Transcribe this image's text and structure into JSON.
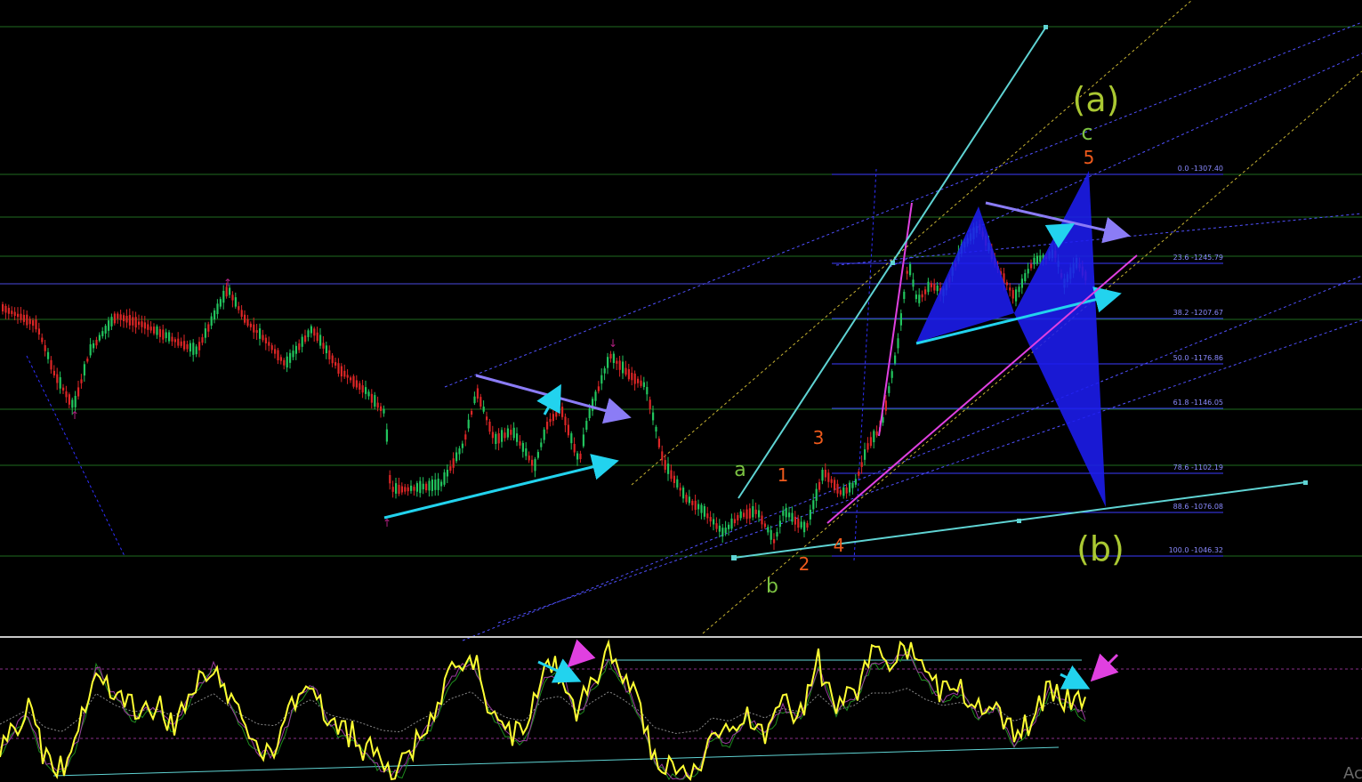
{
  "chart_data": {
    "type": "candlestick",
    "title": "",
    "xlabel": "",
    "ylabel": "",
    "ylim": [
      980,
      1390
    ],
    "grid": true,
    "colors": {
      "background": "#000000",
      "grid_line": "#1f6b1f",
      "candle_up": "#22c55e",
      "candle_down": "#dc2626",
      "fib_line": "#3b3bff",
      "fib_text": "#8a8aff",
      "cyan": "#22d3ee",
      "purple": "#8b7cf6",
      "magenta": "#e040e0",
      "wave_green": "#7cc242",
      "wave_red": "#ef5a1c",
      "wave_olive": "#aac832",
      "harmonic_fill": "#1c1cf0",
      "oscillator": "#ffff33"
    },
    "fibonacci": [
      {
        "label": "0.0 -1307.40",
        "price": 1307.4
      },
      {
        "label": "23.6 -1245.79",
        "price": 1245.79
      },
      {
        "label": "38.2 -1207.67",
        "price": 1207.67
      },
      {
        "label": "50.0 -1176.86",
        "price": 1176.86
      },
      {
        "label": "61.8 -1146.05",
        "price": 1146.05
      },
      {
        "label": "78.6 -1102.19",
        "price": 1102.19
      },
      {
        "label": "88.6 -1076.08",
        "price": 1076.08
      },
      {
        "label": "100.0 -1046.32",
        "price": 1046.32
      }
    ],
    "wave_labels": [
      {
        "text": "(a)",
        "group": "olive"
      },
      {
        "text": "(b)",
        "group": "olive"
      },
      {
        "text": "c",
        "group": "green"
      },
      {
        "text": "a",
        "group": "green"
      },
      {
        "text": "b",
        "group": "green"
      },
      {
        "text": "1",
        "group": "red"
      },
      {
        "text": "2",
        "group": "red"
      },
      {
        "text": "3",
        "group": "red"
      },
      {
        "text": "4",
        "group": "red"
      },
      {
        "text": "5",
        "group": "red"
      }
    ],
    "watermark": "Ac"
  }
}
